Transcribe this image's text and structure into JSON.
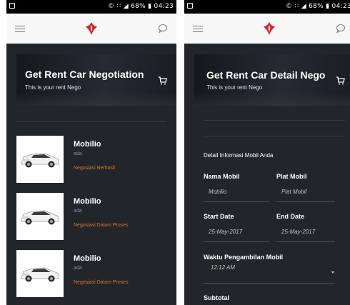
{
  "status_bar": {
    "right_text": "© ∷ ◢ 68% ▮ 04:23"
  },
  "screen1": {
    "header": {
      "title": "Get Rent Car Negotiation",
      "subtitle": "This is your rent Nego"
    },
    "items": [
      {
        "title": "Mobilio",
        "subtitle": "ada",
        "status": "Negosiasi Berhasil"
      },
      {
        "title": "Mobilio",
        "subtitle": "ada",
        "status": "Negosiasi Dalam Proses"
      },
      {
        "title": "Mobilio",
        "subtitle": "ada",
        "status": "Negosiasi Dalam Proses"
      }
    ]
  },
  "screen2": {
    "header": {
      "title": "Get Rent Car Detail Nego",
      "subtitle": "This is your rent Nego"
    },
    "section_label": "Detail Informasi Mobil Anda",
    "fields": {
      "nama_mobil": {
        "label": "Nama Mobil",
        "value": "Mobilio"
      },
      "plat_mobil": {
        "label": "Plat Mobil",
        "value": "Plat Mobil"
      },
      "start_date": {
        "label": "Start Date",
        "value": "25-May-2017"
      },
      "end_date": {
        "label": "End Date",
        "value": "25-May-2017"
      },
      "waktu": {
        "label": "Waktu Pengambilan Mobil",
        "value": "12:12 AM"
      },
      "subtotal": {
        "label": "Subtotal"
      }
    }
  },
  "colors": {
    "background": "#22262b",
    "accent": "#e0702a",
    "logo": "#d8232a",
    "appbar": "#f7f7f7"
  },
  "icons": [
    "menu-icon",
    "logo-icon",
    "chat-icon",
    "cart-icon",
    "dropdown-arrow-icon",
    "car-image"
  ]
}
